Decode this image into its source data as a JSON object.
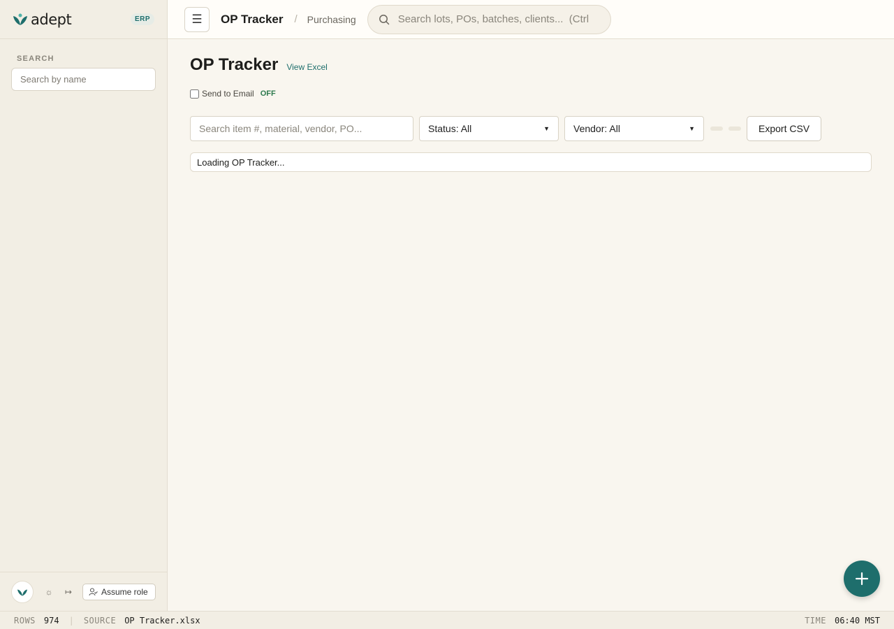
{
  "brand": {
    "name": "adept",
    "tag": "ERP",
    "accent": "#1e6e6c"
  },
  "sidebar": {
    "search_label": "SEARCH",
    "search_placeholder": "Search by name",
    "assume_role": "Assume role"
  },
  "topbar": {
    "title": "OP Tracker",
    "separator": "/",
    "section": "Purchasing",
    "search_placeholder": "Search lots, POs, batches, clients...  (Ctrl"
  },
  "main": {
    "page_title": "OP Tracker",
    "view_excel": "View Excel",
    "send_to_email": "Send to Email",
    "email_state": "OFF",
    "filter_placeholder": "Search item #, material, vendor, PO...",
    "status_filter": "Status: All",
    "vendor_filter": "Vendor: All",
    "export_label": "Export CSV",
    "loading_text": "Loading OP Tracker..."
  },
  "statusbar": {
    "rows_key": "ROWS",
    "rows_value": "974",
    "source_key": "SOURCE",
    "source_value": "OP Tracker.xlsx",
    "time_key": "TIME",
    "time_value": "06:40 MST"
  }
}
